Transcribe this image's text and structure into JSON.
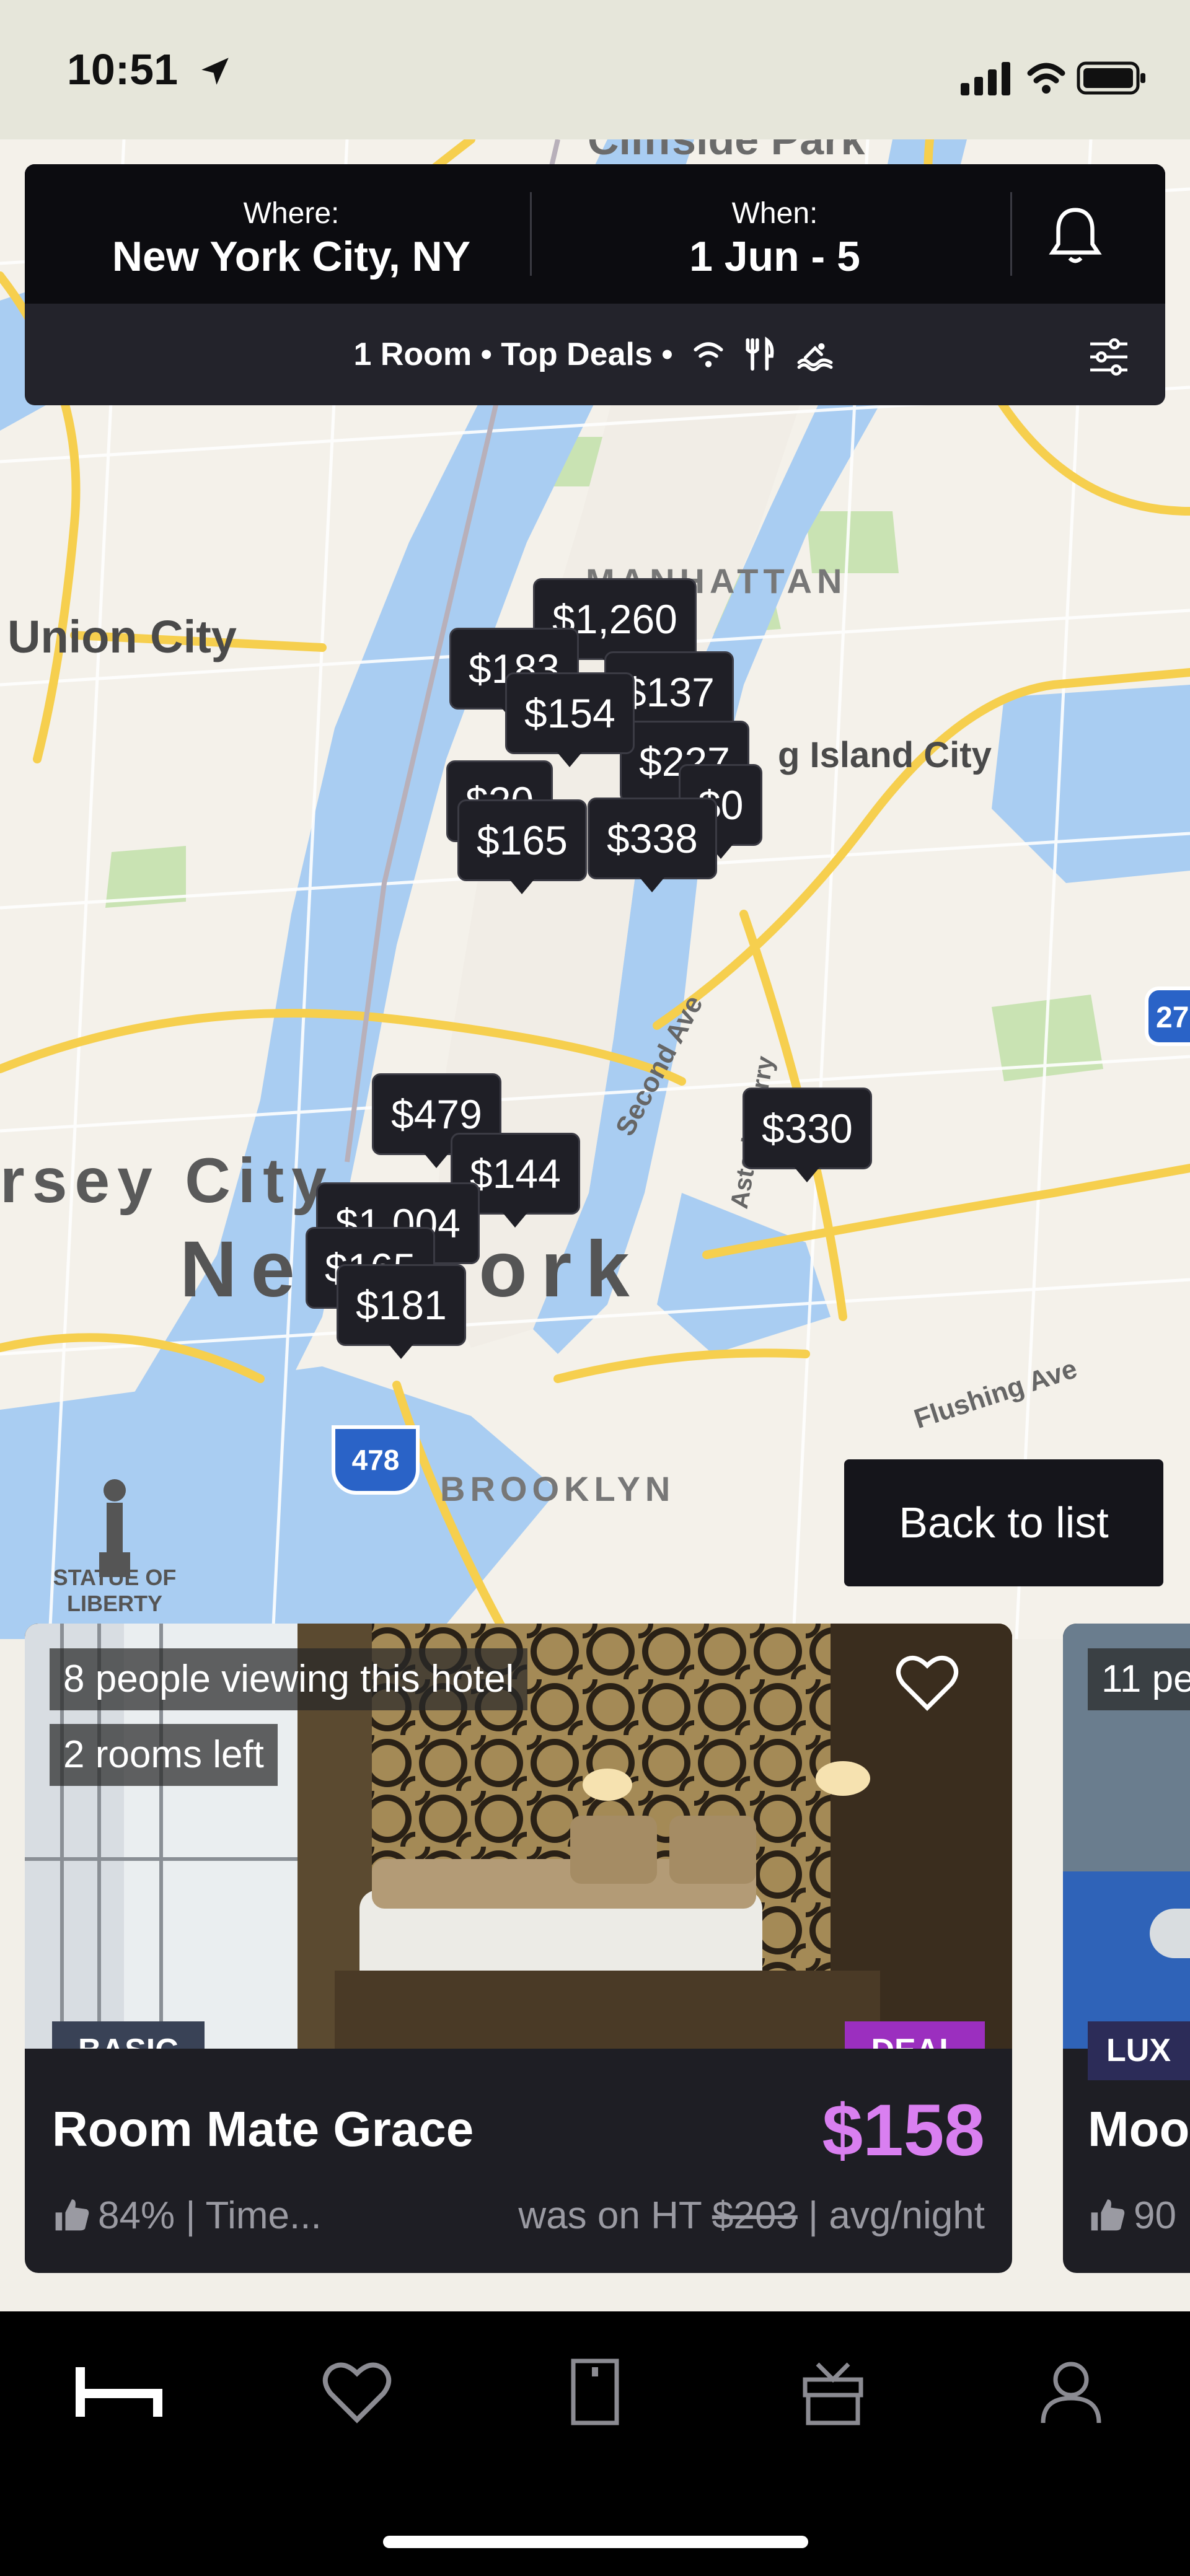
{
  "status_bar": {
    "time": "10:51"
  },
  "search": {
    "where_label": "Where:",
    "where_value": "New York City, NY",
    "when_label": "When:",
    "when_value": "1 Jun - 5",
    "filters_summary": "1 Room • Top Deals •"
  },
  "map": {
    "labels": {
      "cliffside": "Cliffside Park",
      "union_city": "Union City",
      "manhattan": "MANHATTAN",
      "long_island_city": "g Island City",
      "jersey_city": "rsey City",
      "new_york": "New York",
      "brooklyn": "BROOKLYN",
      "statue": "STATUE OF LIBERTY",
      "second_ave": "Second Ave",
      "astoria_ferry": "Astoria Ferry",
      "flushing_ave": "Flushing Ave",
      "highway": "478"
    },
    "pins": [
      "$1,260",
      "$183",
      "$137",
      "$154",
      "$227",
      "$20",
      "$0",
      "$165",
      "$338",
      "$479",
      "$144",
      "$330",
      "$1,004",
      "$165",
      "$181"
    ]
  },
  "back_to_list": "Back to list",
  "hotel_card": {
    "viewing": "8 people viewing this hotel",
    "rooms_left": "2 rooms left",
    "tier": "BASIC",
    "deal": "DEAL",
    "name": "Room Mate Grace",
    "price": "$158",
    "rating": "84% | Time...",
    "was_prefix": "was on HT",
    "was_price": "$203",
    "was_suffix": "| avg/night"
  },
  "hotel_card_next": {
    "viewing": "11 pe",
    "tier": "LUX",
    "name": "Moo",
    "rating": "90"
  },
  "colors": {
    "accent_price": "#d97ff0",
    "deal_badge": "#9b2fbf",
    "water": "#a9cdf2",
    "highway": "#f6cf4e"
  },
  "tabs": [
    "bed-icon",
    "heart-icon",
    "bookmark-door-icon",
    "gift-icon",
    "profile-icon"
  ]
}
